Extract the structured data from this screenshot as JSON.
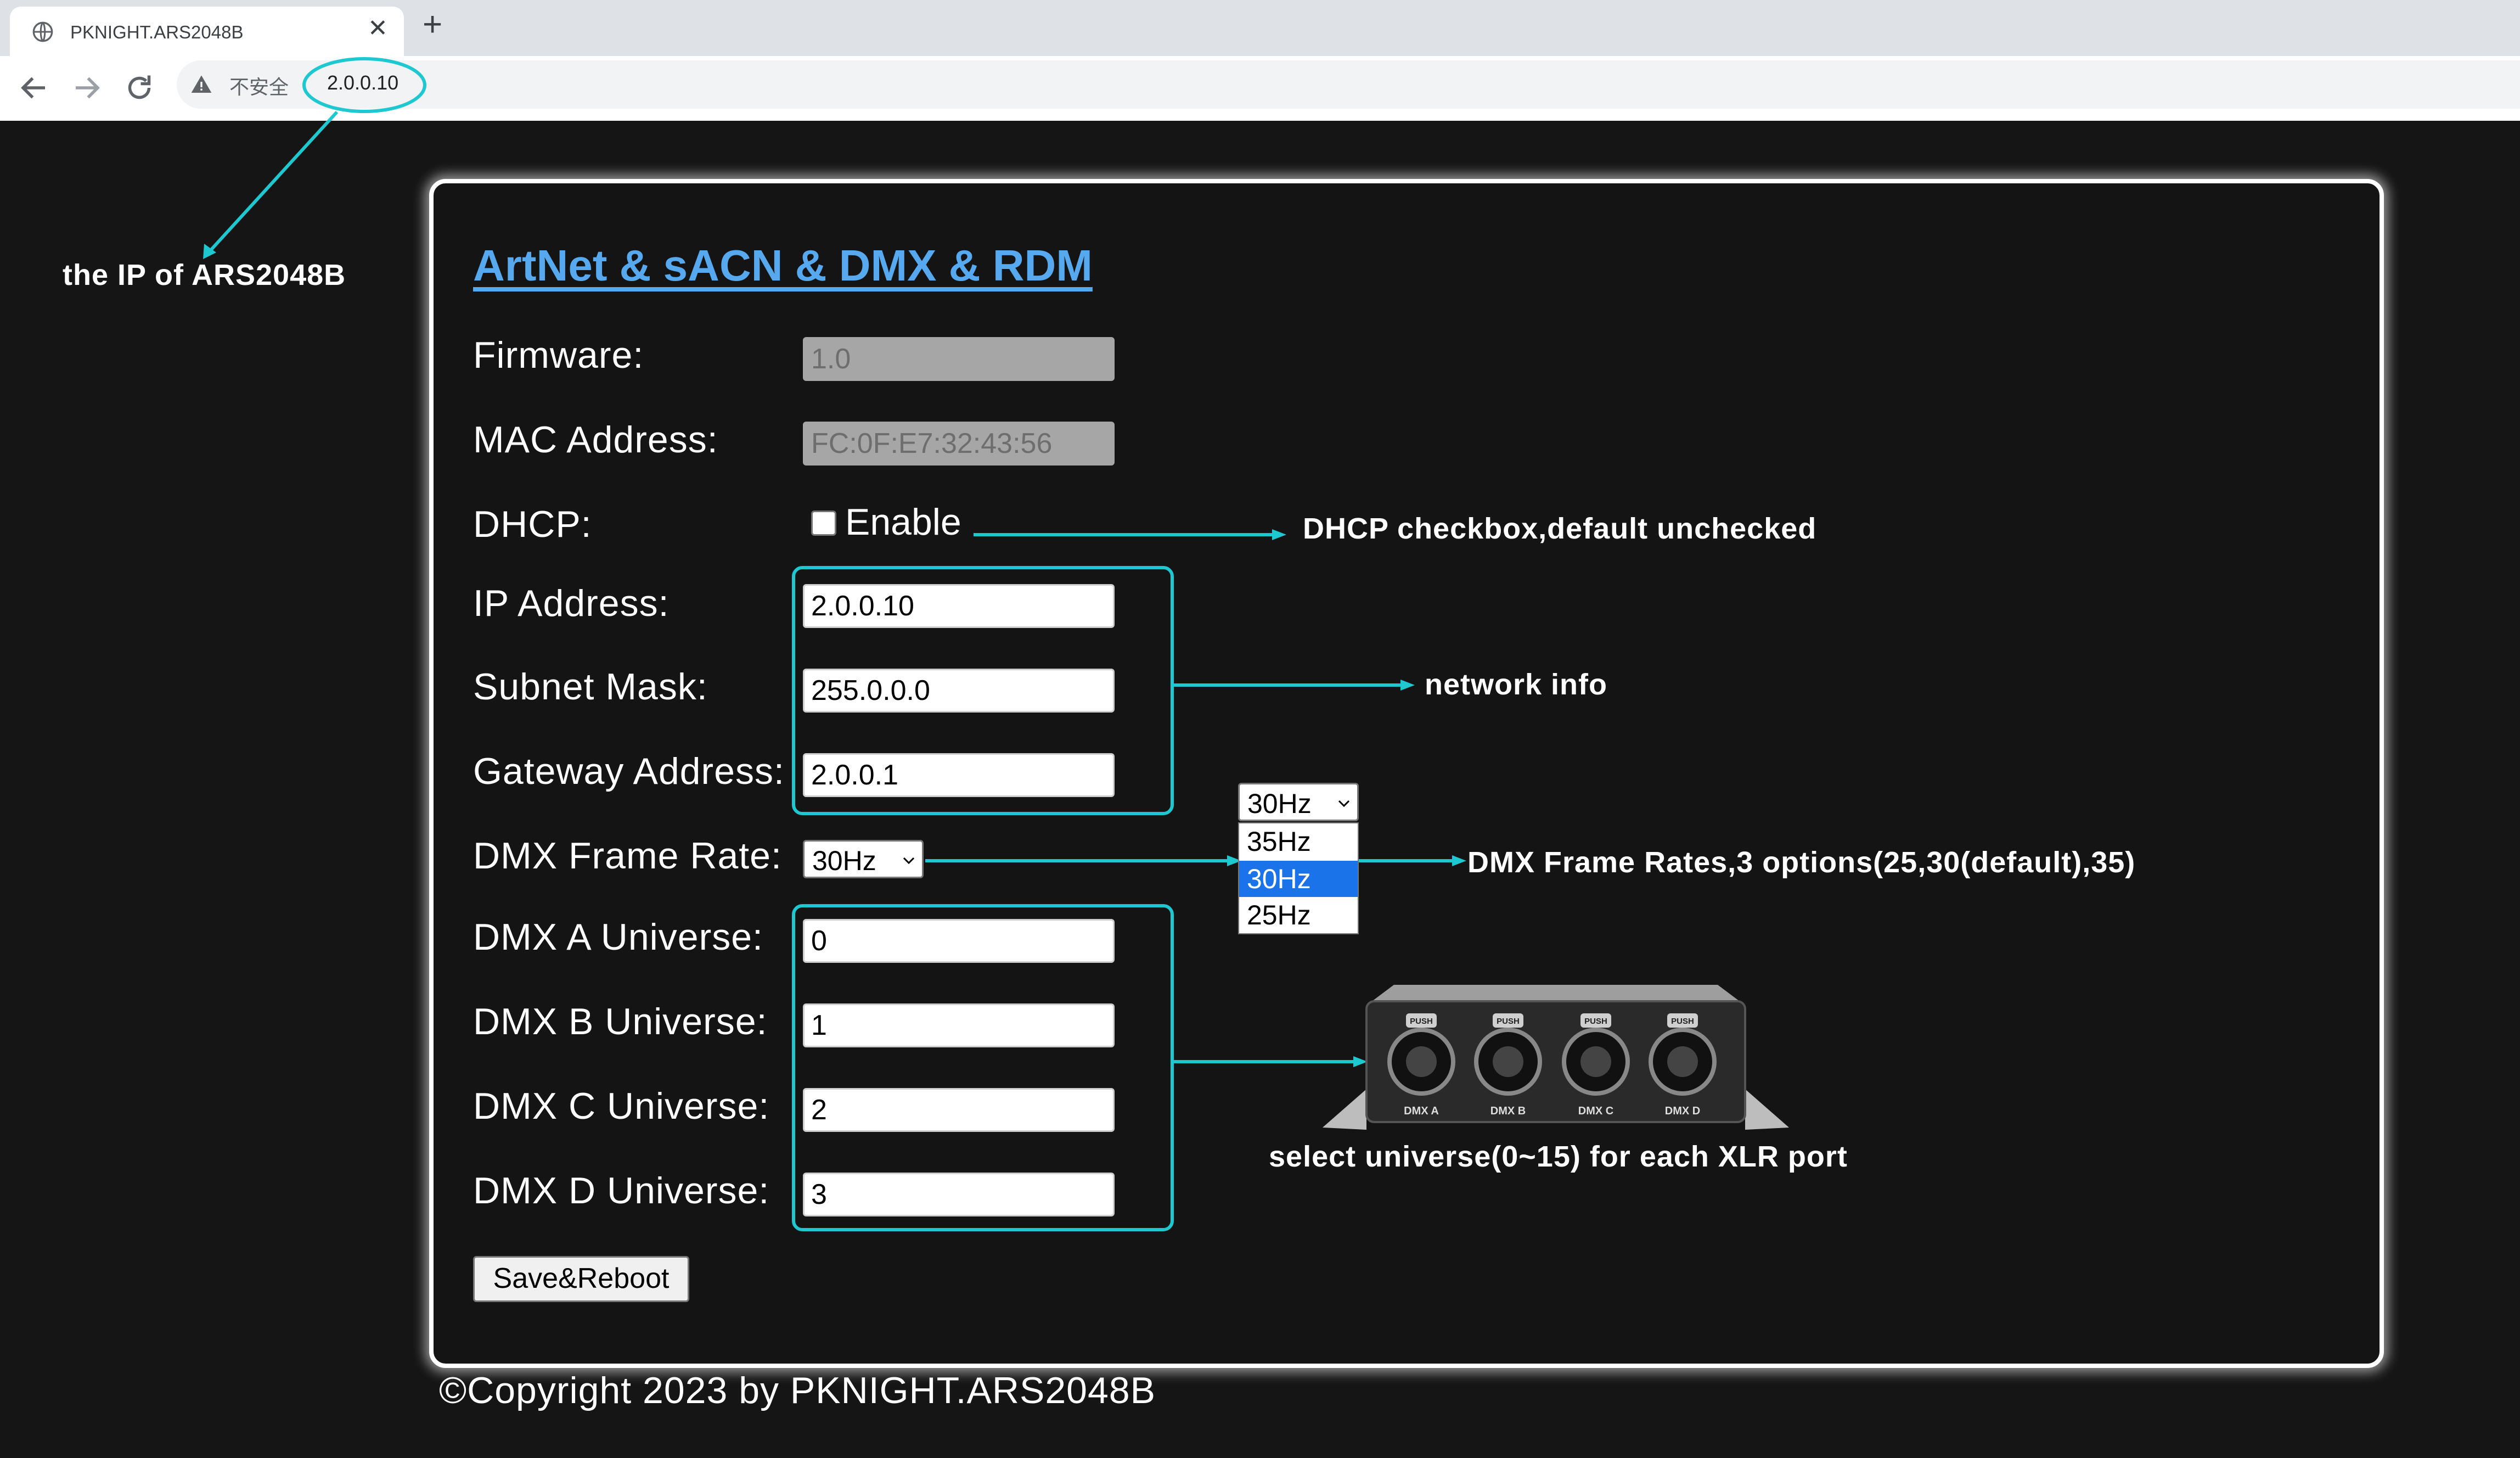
{
  "browser": {
    "tab_title": "PKNIGHT.ARS2048B",
    "security_text": "不安全",
    "url": "2.0.0.10"
  },
  "form": {
    "heading": "ArtNet & sACN & DMX & RDM",
    "firmware_label": "Firmware:",
    "firmware_value": "1.0",
    "mac_label": "MAC Address:",
    "mac_value": "FC:0F:E7:32:43:56",
    "dhcp_label": "DHCP:",
    "dhcp_checkbox_label": "Enable",
    "dhcp_checked": false,
    "ip_label": "IP Address:",
    "ip_value": "2.0.0.10",
    "subnet_label": "Subnet Mask:",
    "subnet_value": "255.0.0.0",
    "gateway_label": "Gateway Address:",
    "gateway_value": "2.0.0.1",
    "frame_rate_label": "DMX Frame Rate:",
    "frame_rate_value": "30Hz",
    "universe_a_label": "DMX A Universe:",
    "universe_a_value": "0",
    "universe_b_label": "DMX B Universe:",
    "universe_b_value": "1",
    "universe_c_label": "DMX C Universe:",
    "universe_c_value": "2",
    "universe_d_label": "DMX D Universe:",
    "universe_d_value": "3",
    "save_label": "Save&Reboot"
  },
  "frame_rate_dropdown": {
    "selected": "30Hz",
    "options": [
      "35Hz",
      "30Hz",
      "25Hz"
    ]
  },
  "annotations": {
    "ip_note": "the IP of ARS2048B",
    "dhcp_note": "DHCP checkbox,default unchecked",
    "network_note": "network info",
    "frame_rate_note": "DMX Frame Rates,3 options(25,30(default),35)",
    "universe_note": "select universe(0~15) for each XLR port"
  },
  "device": {
    "push_label": "PUSH",
    "ports": [
      "DMX A",
      "DMX B",
      "DMX C",
      "DMX D"
    ]
  },
  "footer": {
    "copyright": "©Copyright 2023 by PKNIGHT.ARS2048B"
  },
  "colors": {
    "annotation_accent": "#1ec8d0",
    "heading": "#56a8ef",
    "selected_option": "#1a73e8"
  }
}
